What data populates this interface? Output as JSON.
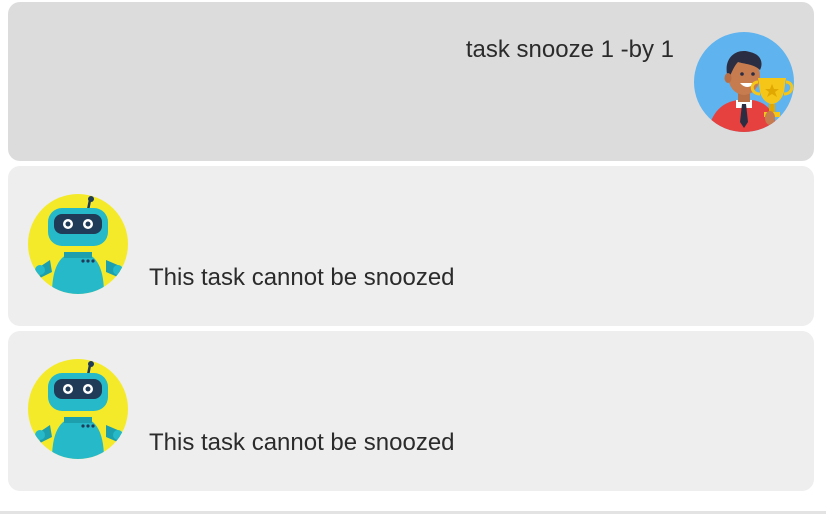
{
  "messages": [
    {
      "role": "user",
      "avatar_icon": "user-trophy-avatar-icon",
      "text": "task snooze 1 -by 1"
    },
    {
      "role": "bot",
      "avatar_icon": "robot-avatar-icon",
      "text": "This task cannot be snoozed"
    },
    {
      "role": "bot",
      "avatar_icon": "robot-avatar-icon",
      "text": "This task cannot be snoozed"
    }
  ],
  "colors": {
    "user_bubble": "#dcdcdc",
    "bot_bubble": "#eeeeee",
    "text": "#2b2b2b",
    "user_avatar_bg": "#5fb3ee",
    "bot_avatar_bg": "#f4ea2a",
    "robot_body": "#26b9c9"
  }
}
